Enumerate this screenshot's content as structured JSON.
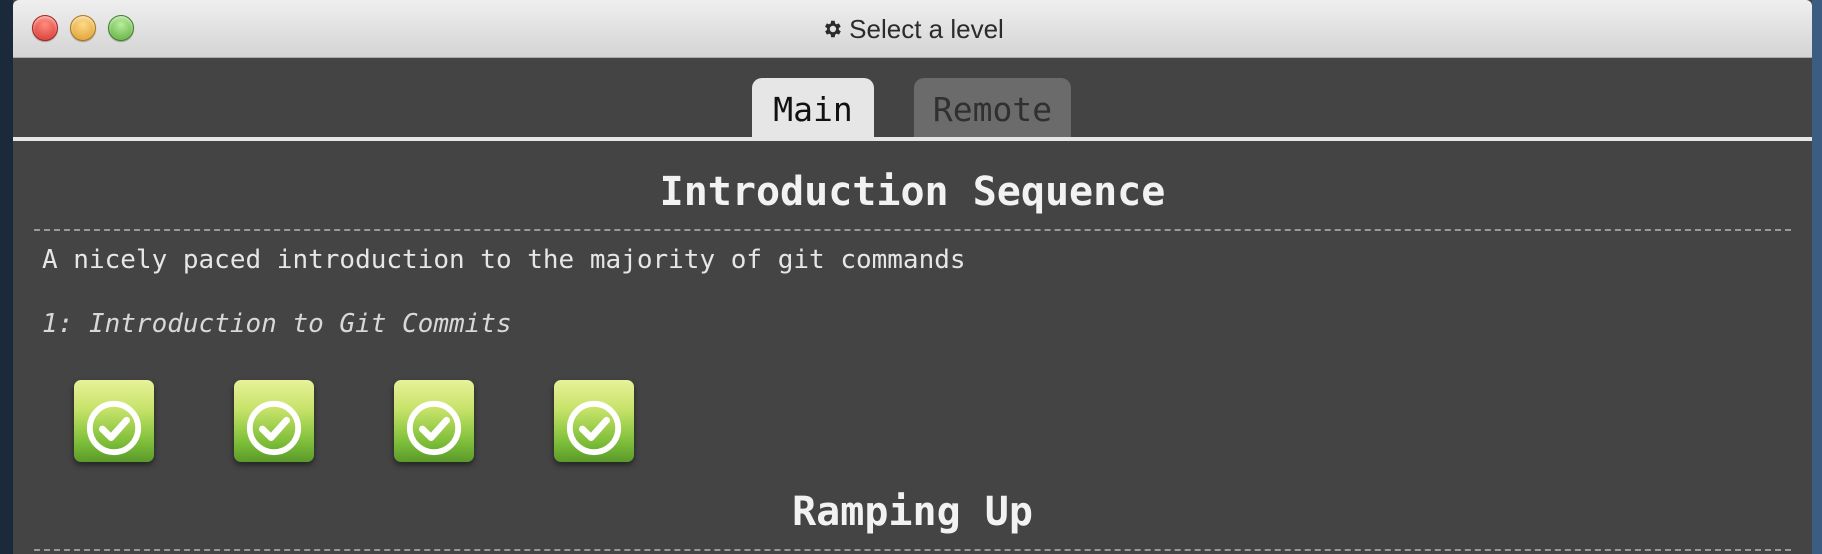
{
  "window": {
    "title": "Select a level",
    "title_icon": "gear-icon"
  },
  "tabs": [
    {
      "label": "Main",
      "active": true
    },
    {
      "label": "Remote",
      "active": false
    }
  ],
  "sections": [
    {
      "title": "Introduction Sequence",
      "description": "A nicely paced introduction to the majority of git commands",
      "selected_level": "1: Introduction to Git Commits",
      "levels": [
        {
          "status": "completed",
          "icon": "check-circle-icon"
        },
        {
          "status": "completed",
          "icon": "check-circle-icon"
        },
        {
          "status": "completed",
          "icon": "check-circle-icon"
        },
        {
          "status": "completed",
          "icon": "check-circle-icon"
        }
      ]
    },
    {
      "title": "Ramping Up"
    }
  ],
  "colors": {
    "background": "#444444",
    "tab_active": "#e6e6e6",
    "tab_inactive": "#6b6b6b",
    "level_green": "#7fbf3a"
  }
}
